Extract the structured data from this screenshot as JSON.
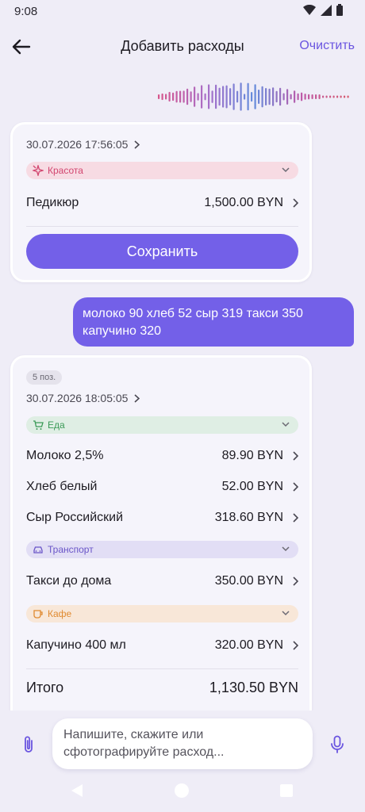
{
  "status": {
    "time": "9:08"
  },
  "header": {
    "title": "Добавить расходы",
    "clear_label": "Очистить"
  },
  "card1": {
    "datetime": "30.07.2026 17:56:05",
    "category": "Красота",
    "item": {
      "name": "Педикюр",
      "amount": "1,500.00 BYN"
    },
    "save_label": "Сохранить"
  },
  "user_message": "молоко 90 хлеб 52 сыр 319 такси 350 капучино 320",
  "card2": {
    "positions": "5 поз.",
    "datetime": "30.07.2026 18:05:05",
    "groups": [
      {
        "category": "Еда",
        "items": [
          {
            "name": "Молоко 2,5%",
            "amount": "89.90 BYN"
          },
          {
            "name": "Хлеб белый",
            "amount": "52.00 BYN"
          },
          {
            "name": "Сыр Российский",
            "amount": "318.60 BYN"
          }
        ]
      },
      {
        "category": "Транспорт",
        "items": [
          {
            "name": "Такси до дома",
            "amount": "350.00 BYN"
          }
        ]
      },
      {
        "category": "Кафе",
        "items": [
          {
            "name": "Капучино 400 мл",
            "amount": "320.00 BYN"
          }
        ]
      }
    ],
    "total_label": "Итого",
    "total_amount": "1,130.50 BYN"
  },
  "composer": {
    "placeholder": "Напишите, скажите или сфотографируйте расход..."
  },
  "colors": {
    "accent": "#7360e8",
    "beauty": "#d2456f",
    "food": "#3a9a57",
    "transport": "#6a55c8",
    "cafe": "#e08a30"
  },
  "icons": [
    "back-arrow-icon",
    "wifi-icon",
    "signal-icon",
    "battery-icon",
    "chevron-right-icon",
    "chevron-down-icon",
    "sparkle-icon",
    "cart-icon",
    "car-icon",
    "cup-icon",
    "paperclip-icon",
    "microphone-icon"
  ]
}
